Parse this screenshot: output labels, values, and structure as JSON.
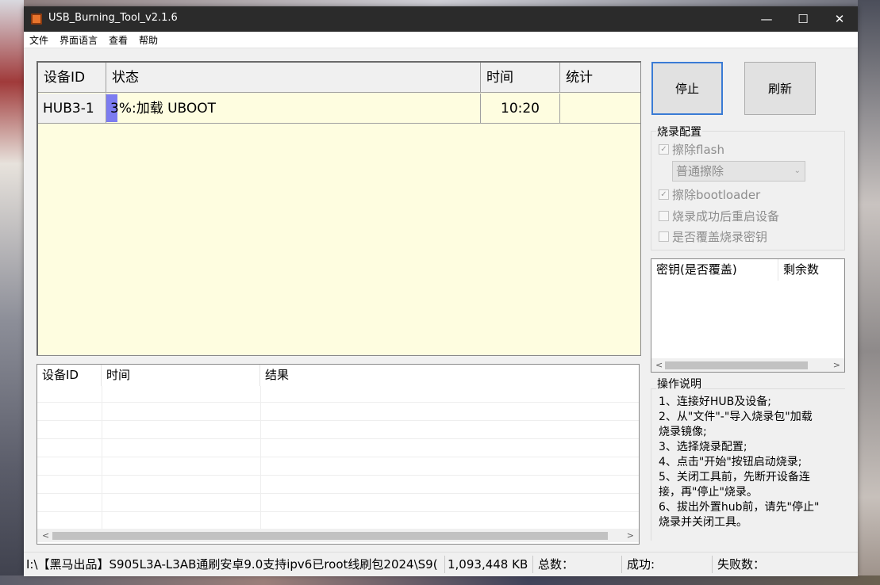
{
  "window": {
    "title": "USB_Burning_Tool_v2.1.6"
  },
  "window_controls": {
    "minimize": "—",
    "maximize": "☐",
    "close": "✕"
  },
  "menu": [
    "文件",
    "界面语言",
    "查看",
    "帮助"
  ],
  "device_grid": {
    "headers": [
      "设备ID",
      "状态",
      "时间",
      "统计"
    ],
    "row": {
      "device_id": "HUB3-1",
      "status": "3%:加载 UBOOT",
      "progress": 0.03,
      "time": "10:20",
      "stats": ""
    }
  },
  "buttons": {
    "stop": "停止",
    "refresh": "刷新"
  },
  "burn_config": {
    "title": "烧录配置",
    "erase_flash": {
      "label": "擦除flash",
      "checked": true
    },
    "erase_mode": "普通擦除",
    "erase_bootloader": {
      "label": "擦除bootloader",
      "checked": true
    },
    "reboot_after": {
      "label": "烧录成功后重启设备",
      "checked": false
    },
    "overwrite_key": {
      "label": "是否覆盖烧录密钥",
      "checked": false
    }
  },
  "key_list": {
    "headers": [
      "密钥(是否覆盖)",
      "剩余数"
    ]
  },
  "result_list": {
    "headers": [
      "设备ID",
      "时间",
      "结果"
    ]
  },
  "instructions": {
    "title": "操作说明",
    "lines": [
      "1、连接好HUB及设备;",
      "2、从\"文件\"-\"导入烧录包\"加载",
      "烧录镜像;",
      "3、选择烧录配置;",
      "4、点击\"开始\"按钮启动烧录;",
      "5、关闭工具前，先断开设备连",
      "接，再\"停止\"烧录。",
      "6、拔出外置hub前，请先\"停止\"",
      "烧录并关闭工具。"
    ]
  },
  "status_bar": {
    "path": "I:\\【黑马出品】S905L3A-L3AB通刷安卓9.0支持ipv6已root线刷包2024\\S9(",
    "size": "1,093,448 KB",
    "total": "总数：",
    "success": "成功:",
    "fail": "失败数："
  }
}
